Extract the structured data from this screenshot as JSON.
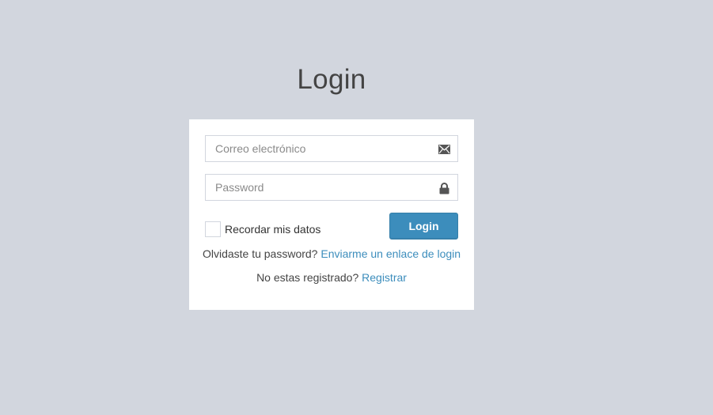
{
  "page": {
    "title": "Login",
    "background_color": "#d2d6de"
  },
  "form": {
    "email": {
      "placeholder": "Correo electrónico",
      "value": "",
      "icon": "envelope-icon"
    },
    "password": {
      "placeholder": "Password",
      "value": "",
      "icon": "lock-icon"
    },
    "remember": {
      "label": "Recordar mis datos",
      "checked": false
    },
    "submit_label": "Login"
  },
  "links": {
    "forgot_prefix": "Olvidaste tu password?",
    "forgot_link": "Enviarme un enlace de login",
    "register_prefix": "No estas registrado?",
    "register_link": "Registrar"
  },
  "colors": {
    "accent": "#3c8dbc",
    "box_background": "#ffffff"
  }
}
